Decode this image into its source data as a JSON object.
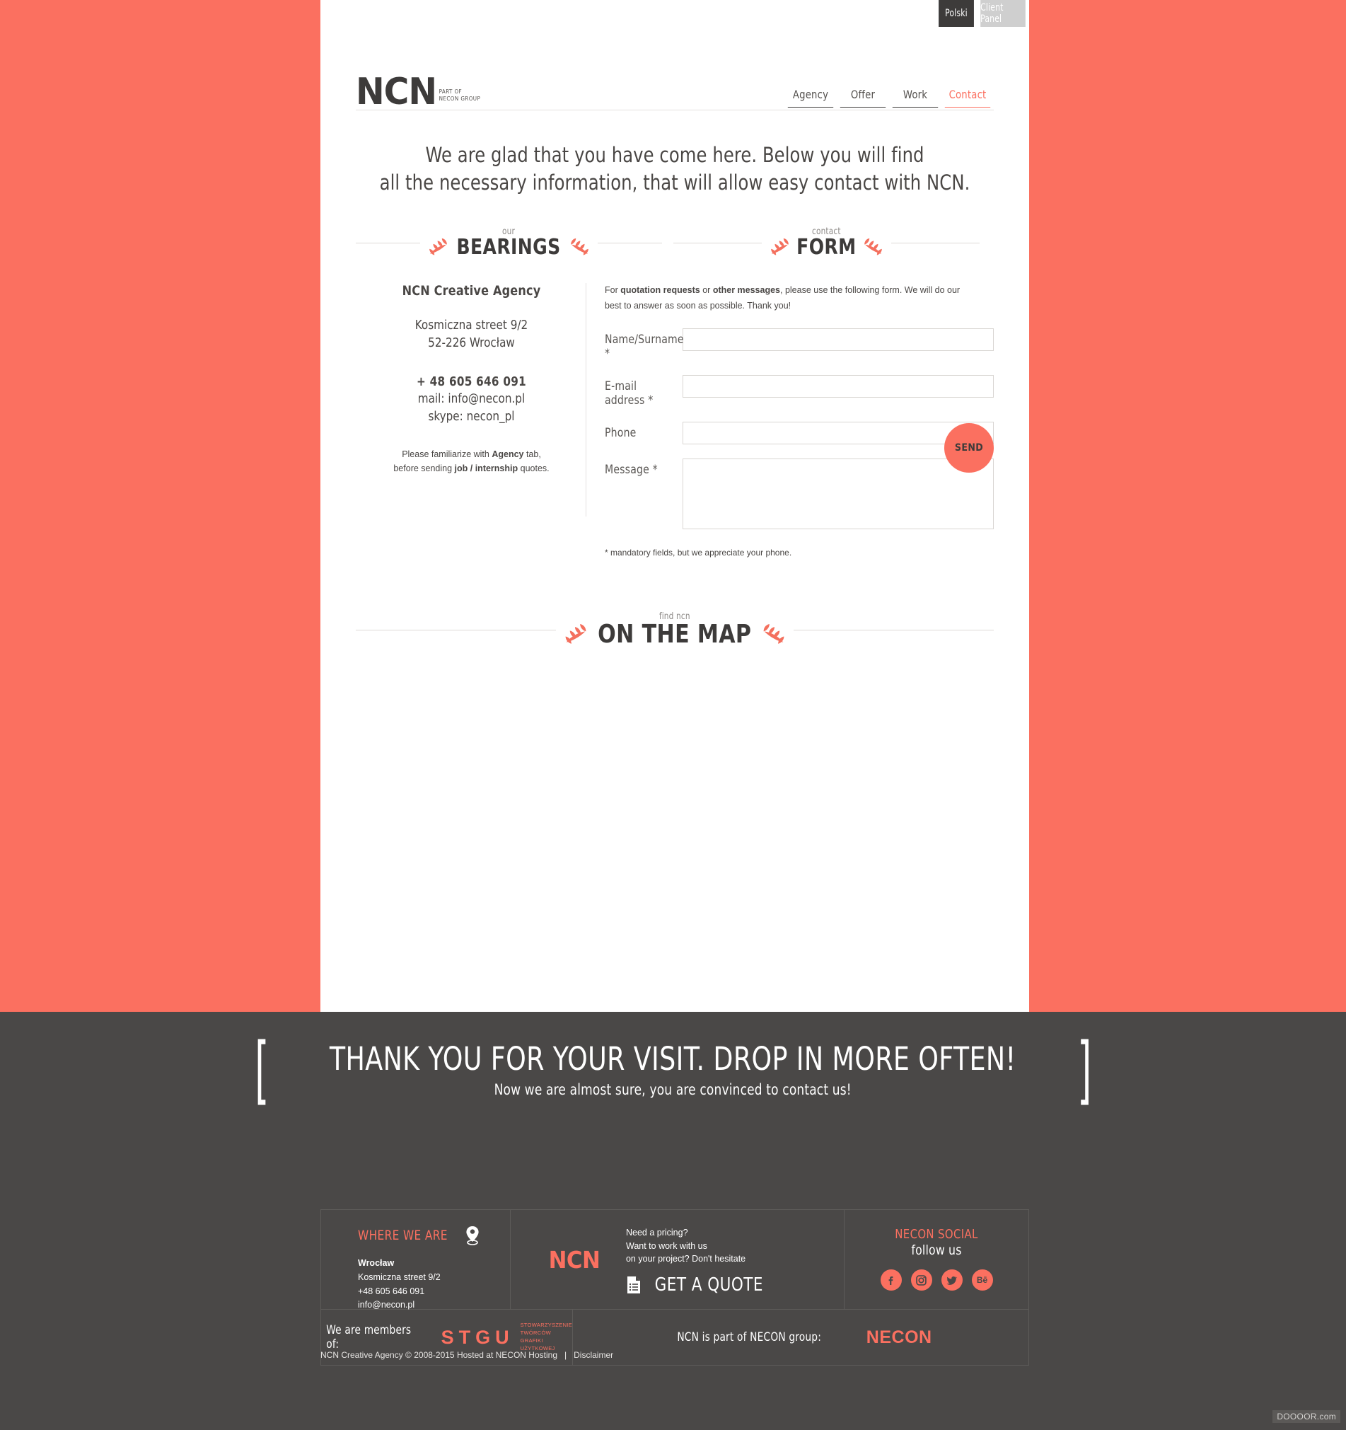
{
  "colors": {
    "coral": "#FB7060",
    "dark": "#4A4847",
    "text": "#4a4745"
  },
  "topbar": {
    "language_button": "Polski",
    "client_panel_button": "Client Panel"
  },
  "header": {
    "logo_mark": "NCN",
    "logo_sub_line1": "PART OF",
    "logo_sub_line2": "NECON GROUP",
    "nav": [
      {
        "label": "Agency",
        "active": false
      },
      {
        "label": "Offer",
        "active": false
      },
      {
        "label": "Work",
        "active": false
      },
      {
        "label": "Contact",
        "active": true
      }
    ]
  },
  "intro": {
    "line1": "We are glad that you have come here. Below you will find",
    "line2": "all the necessary information, that will allow easy contact with NCN."
  },
  "sections": {
    "bearings": {
      "small": "our",
      "big": "BEARINGS"
    },
    "form": {
      "small": "contact",
      "big": "FORM"
    },
    "map": {
      "small": "find ncn",
      "big": "ON THE MAP"
    }
  },
  "bearings": {
    "company": "NCN Creative Agency",
    "address_line1": "Kosmiczna street 9/2",
    "address_line2": "52-226 Wrocław",
    "phone": "+ 48 605 646 091",
    "mail": "mail: info@necon.pl",
    "skype": "skype: necon_pl",
    "note_a": "Please familiarize with ",
    "note_b": "Agency",
    "note_c": " tab,",
    "note_d": "before sending ",
    "note_e": "job / internship",
    "note_f": " quotes."
  },
  "form": {
    "lead_a": "For ",
    "lead_b": "quotation requests",
    "lead_c": " or ",
    "lead_d": "other messages",
    "lead_e": ", please use the following form. We will do our best to answer as soon as possible. Thank you!",
    "fields": [
      {
        "label": "Name/Surname *",
        "value": "",
        "placeholder": ""
      },
      {
        "label": "E-mail address *",
        "value": "",
        "placeholder": ""
      },
      {
        "label": "Phone",
        "value": "",
        "placeholder": ""
      },
      {
        "label": "Message *",
        "value": "",
        "placeholder": ""
      }
    ],
    "note": "* mandatory fields, but we appreciate your phone.",
    "send_label": "SEND"
  },
  "footer": {
    "thanks_main": "THANK YOU FOR YOUR VISIT. DROP IN MORE OFTEN!",
    "thanks_sub": "Now we are almost sure, you are convinced to contact us!",
    "bracket_left": "[",
    "bracket_right": "]",
    "where": {
      "title": "WHERE WE ARE",
      "city": "Wrocław",
      "street": "Kosmiczna street 9/2",
      "phone": "+48 605 646 091",
      "email": "info@necon.pl"
    },
    "quote": {
      "logo": "NCN",
      "line1": "Need a pricing?",
      "line2": "Want to work with us",
      "line3": "on your project? Don't hesitate",
      "cta": "GET A QUOTE"
    },
    "social": {
      "title": "NECON SOCIAL",
      "subtitle": "follow us",
      "items": [
        {
          "name": "facebook",
          "glyph": "f"
        },
        {
          "name": "instagram",
          "glyph": ""
        },
        {
          "name": "twitter",
          "glyph": ""
        },
        {
          "name": "behance",
          "glyph": "Bē"
        }
      ]
    },
    "members": {
      "label": "We are members of:",
      "logo_letters": "STGU",
      "desc_line1": "STOWARZYSZENIE",
      "desc_line2": "TWÓRCÓW",
      "desc_line3": "GRAFIKI",
      "desc_line4": "UŻYTKOWEJ"
    },
    "group": {
      "label": "NCN is part of NECON group:",
      "logo": "NECON"
    },
    "copyright": "NCN Creative Agency © 2008-2015  Hosted at NECON Hosting",
    "separator": "|",
    "disclaimer": "Disclaimer"
  },
  "watermark": "DOOOOR.com"
}
